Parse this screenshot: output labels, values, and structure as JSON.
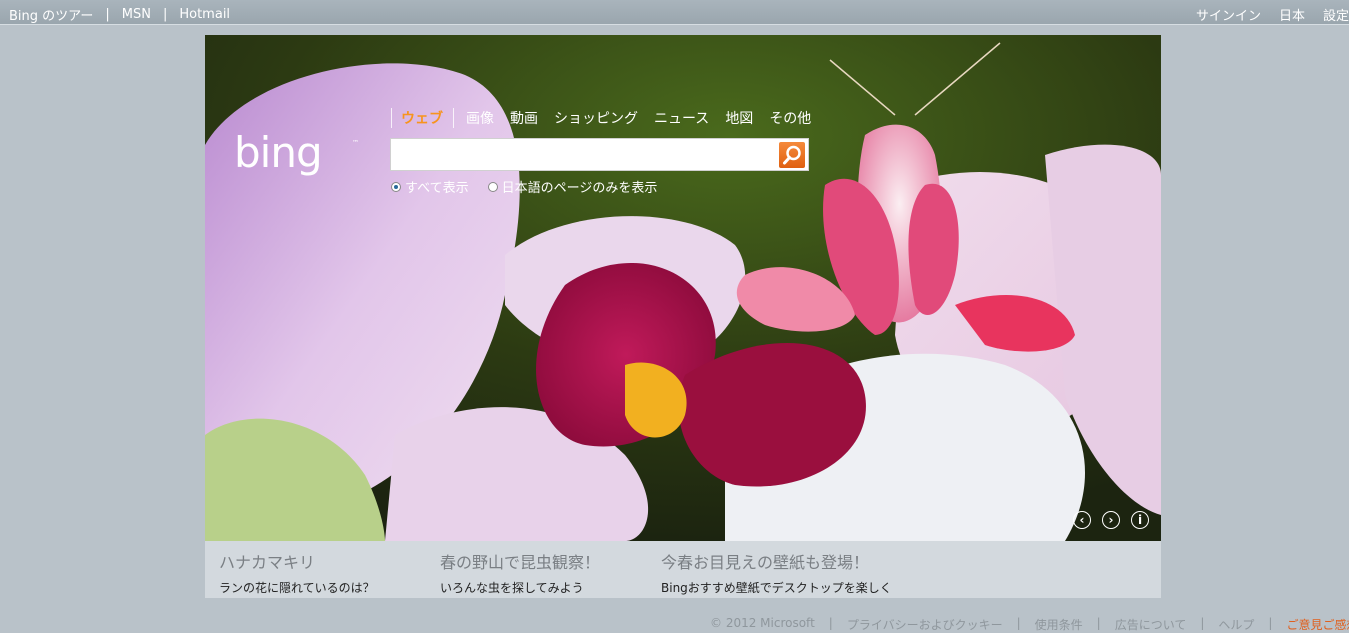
{
  "topbar": {
    "left_links": [
      "Bing のツアー",
      "MSN",
      "Hotmail"
    ],
    "right_links": [
      "サインイン",
      "日本",
      "設定"
    ]
  },
  "search": {
    "scopes": [
      "ウェブ",
      "画像",
      "動画",
      "ショッピング",
      "ニュース",
      "地図",
      "その他"
    ],
    "active_scope": "ウェブ",
    "query": "",
    "radio_all": "すべて表示",
    "radio_japanese": "日本語のページのみを表示"
  },
  "logo_text": "bing",
  "hotspots": [
    {
      "title": "ハナカマキリ",
      "subtitle": "ランの花に隠れているのは？"
    },
    {
      "title": "春の野山で昆虫観察！",
      "subtitle": "いろんな虫を探してみよう"
    },
    {
      "title": "今春お目見えの壁紙も登場！",
      "subtitle": "Bingおすすめ壁紙でデスクトップを楽しく"
    }
  ],
  "footer": {
    "copyright": "© 2012 Microsoft",
    "links": [
      "プライバシーおよびクッキー",
      "使用条件",
      "広告について",
      "ヘルプ"
    ],
    "feedback": "ご意見ご感想"
  },
  "colors": {
    "accent": "#f7941d",
    "search_button": "#e8701a",
    "background": "#b9c2c9"
  },
  "icons": [
    "search-icon",
    "prev-arrow-icon",
    "next-arrow-icon",
    "info-icon"
  ]
}
